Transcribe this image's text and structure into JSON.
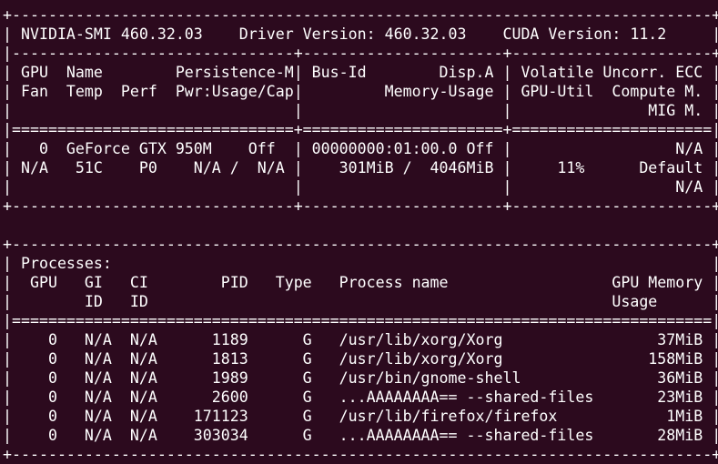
{
  "terminal": {
    "background": "#2c0a1e",
    "foreground": "#ffffff",
    "lines": [
      "+-----------------------------------------------------------------------------+",
      "| NVIDIA-SMI 460.32.03    Driver Version: 460.32.03    CUDA Version: 11.2     |",
      "|-------------------------------+----------------------+----------------------+",
      "| GPU  Name        Persistence-M| Bus-Id        Disp.A | Volatile Uncorr. ECC |",
      "| Fan  Temp  Perf  Pwr:Usage/Cap|         Memory-Usage | GPU-Util  Compute M. |",
      "|                               |                      |               MIG M. |",
      "|===============================+======================+======================|",
      "|   0  GeForce GTX 950M    Off  | 00000000:01:00.0 Off |                  N/A |",
      "| N/A   51C    P0    N/A /  N/A |    301MiB /  4046MiB |     11%      Default |",
      "|                               |                      |                  N/A |",
      "+-------------------------------+----------------------+----------------------+",
      "",
      "+-----------------------------------------------------------------------------+",
      "| Processes:                                                                  |",
      "|  GPU   GI   CI        PID   Type   Process name                  GPU Memory |",
      "|        ID   ID                                                   Usage      |",
      "|=============================================================================|",
      "|    0   N/A  N/A      1189      G   /usr/lib/xorg/Xorg                 37MiB |",
      "|    0   N/A  N/A      1813      G   /usr/lib/xorg/Xorg                158MiB |",
      "|    0   N/A  N/A      1989      G   /usr/bin/gnome-shell               36MiB |",
      "|    0   N/A  N/A      2600      G   ...AAAAAAAA== --shared-files       23MiB |",
      "|    0   N/A  N/A    171123      G   /usr/lib/firefox/firefox            1MiB |",
      "|    0   N/A  N/A    303034      G   ...AAAAAAAA== --shared-files       28MiB |",
      "+-----------------------------------------------------------------------------+"
    ]
  }
}
